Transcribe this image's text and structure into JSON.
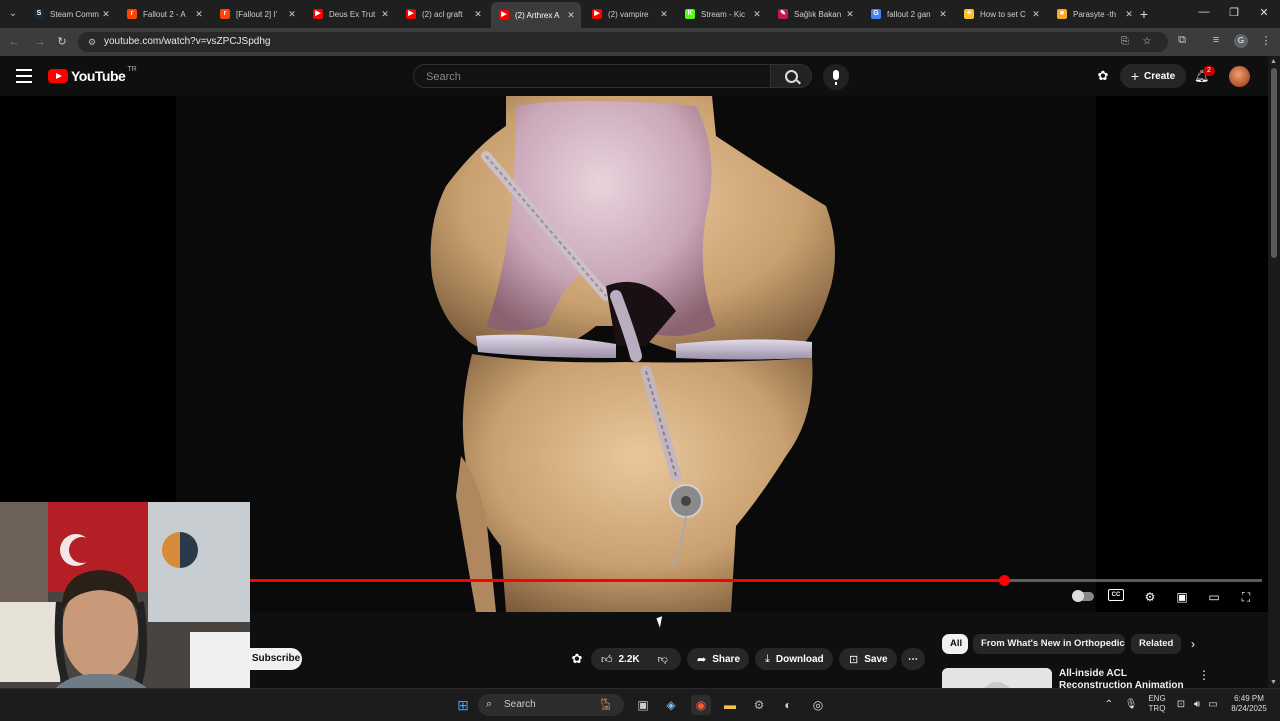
{
  "browser": {
    "tabs": [
      {
        "label": "Steam Comm",
        "icon": "steam-icon",
        "color": "#1b2838",
        "glyph": "S",
        "active": false
      },
      {
        "label": "Fallout 2 - A",
        "icon": "reddit-icon",
        "color": "#ff4500",
        "glyph": "r",
        "active": false
      },
      {
        "label": "[Fallout 2] I'",
        "icon": "reddit-icon",
        "color": "#ff4500",
        "glyph": "r",
        "active": false
      },
      {
        "label": "Deus Ex Trut",
        "icon": "youtube-icon",
        "color": "#ff0000",
        "glyph": "▶",
        "active": false
      },
      {
        "label": "(2) acl graft",
        "icon": "youtube-icon",
        "color": "#ff0000",
        "glyph": "▶",
        "active": false
      },
      {
        "label": "(2) Arthrex A",
        "icon": "youtube-icon",
        "color": "#ff0000",
        "glyph": "▶",
        "active": true
      },
      {
        "label": "(2) vampire",
        "icon": "youtube-icon",
        "color": "#ff0000",
        "glyph": "▶",
        "active": false
      },
      {
        "label": "Stream - Kic",
        "icon": "kick-icon",
        "color": "#53fc18",
        "glyph": "K",
        "active": false
      },
      {
        "label": "Sağlık Bakan",
        "icon": "feather-icon",
        "color": "#c2185b",
        "glyph": "✎",
        "active": false
      },
      {
        "label": "fallout 2 gan",
        "icon": "google-icon",
        "color": "#4285f4",
        "glyph": "G",
        "active": false
      },
      {
        "label": "How to set C",
        "icon": "bulb-icon",
        "color": "#fbc02d",
        "glyph": "✦",
        "active": false
      },
      {
        "label": "Parasyte -th",
        "icon": "folder-icon",
        "color": "#f9a825",
        "glyph": "■",
        "active": false
      }
    ],
    "url": "youtube.com/watch?v=vsZPCJSpdhg",
    "profile_initial": "G"
  },
  "masthead": {
    "logo_text": "YouTube",
    "country_code": "TR",
    "search_placeholder": "Search",
    "create_label": "Create",
    "notification_count": "2"
  },
  "player": {
    "progress_fraction": 0.745
  },
  "below_video": {
    "subscribe_label": "Subscribe",
    "like_count": "2.2K",
    "share_label": "Share",
    "download_label": "Download",
    "save_label": "Save"
  },
  "chips": [
    {
      "label": "All",
      "selected": true
    },
    {
      "label": "From What's New in Orthopedics",
      "selected": false
    },
    {
      "label": "Related",
      "selected": false
    }
  ],
  "recommendation": {
    "title": "All-inside ACL Reconstruction Animation"
  },
  "taskbar": {
    "search_label": "Search",
    "language_top": "ENG",
    "language_bottom": "TRQ",
    "time": "6:49 PM",
    "date": "8/24/2025"
  }
}
